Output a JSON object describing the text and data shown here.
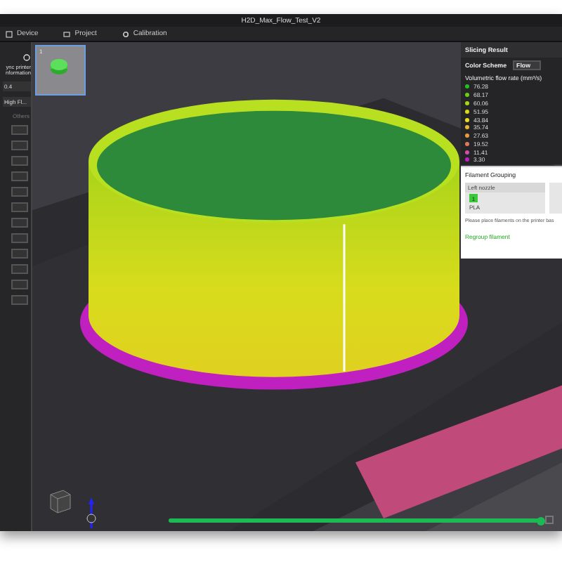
{
  "window": {
    "title": "H2D_Max_Flow_Test_V2"
  },
  "tabs": [
    {
      "label": "Device",
      "selected": false
    },
    {
      "label": "Project",
      "selected": false
    },
    {
      "label": "Calibration",
      "selected": false
    }
  ],
  "sidebar": {
    "sync_label": "ync printer nformation",
    "nozzle": "0.4",
    "filament": "High Fl...",
    "tab": "Others"
  },
  "viewport": {
    "kind": "picture",
    "plate_number": "1"
  },
  "slicing_result": {
    "title": "Slicing Result",
    "color_scheme_label": "Color Scheme",
    "color_scheme": "Flow",
    "legend_title": "Volumetric flow rate (mm³/s)",
    "legend": [
      {
        "value": "76.28",
        "color": "#22c020"
      },
      {
        "value": "68.17",
        "color": "#6ccb1a"
      },
      {
        "value": "60.06",
        "color": "#a8d41a"
      },
      {
        "value": "51.95",
        "color": "#d6dc1c"
      },
      {
        "value": "43.84",
        "color": "#e8e020"
      },
      {
        "value": "35.74",
        "color": "#e8b830"
      },
      {
        "value": "27.63",
        "color": "#e89a40"
      },
      {
        "value": "19.52",
        "color": "#e07860"
      },
      {
        "value": "11.41",
        "color": "#d050a8"
      },
      {
        "value": "3.30",
        "color": "#c020c0"
      }
    ]
  },
  "filament_grouping": {
    "title": "Filament Grouping",
    "nozzle": "Left nozzle",
    "slot": {
      "label": "1",
      "color": "#3cc83c"
    },
    "material": "PLA",
    "note": "Please place filaments on the printer bas",
    "action": "Regroup filament"
  },
  "layer_slider": {
    "level": 1
  }
}
